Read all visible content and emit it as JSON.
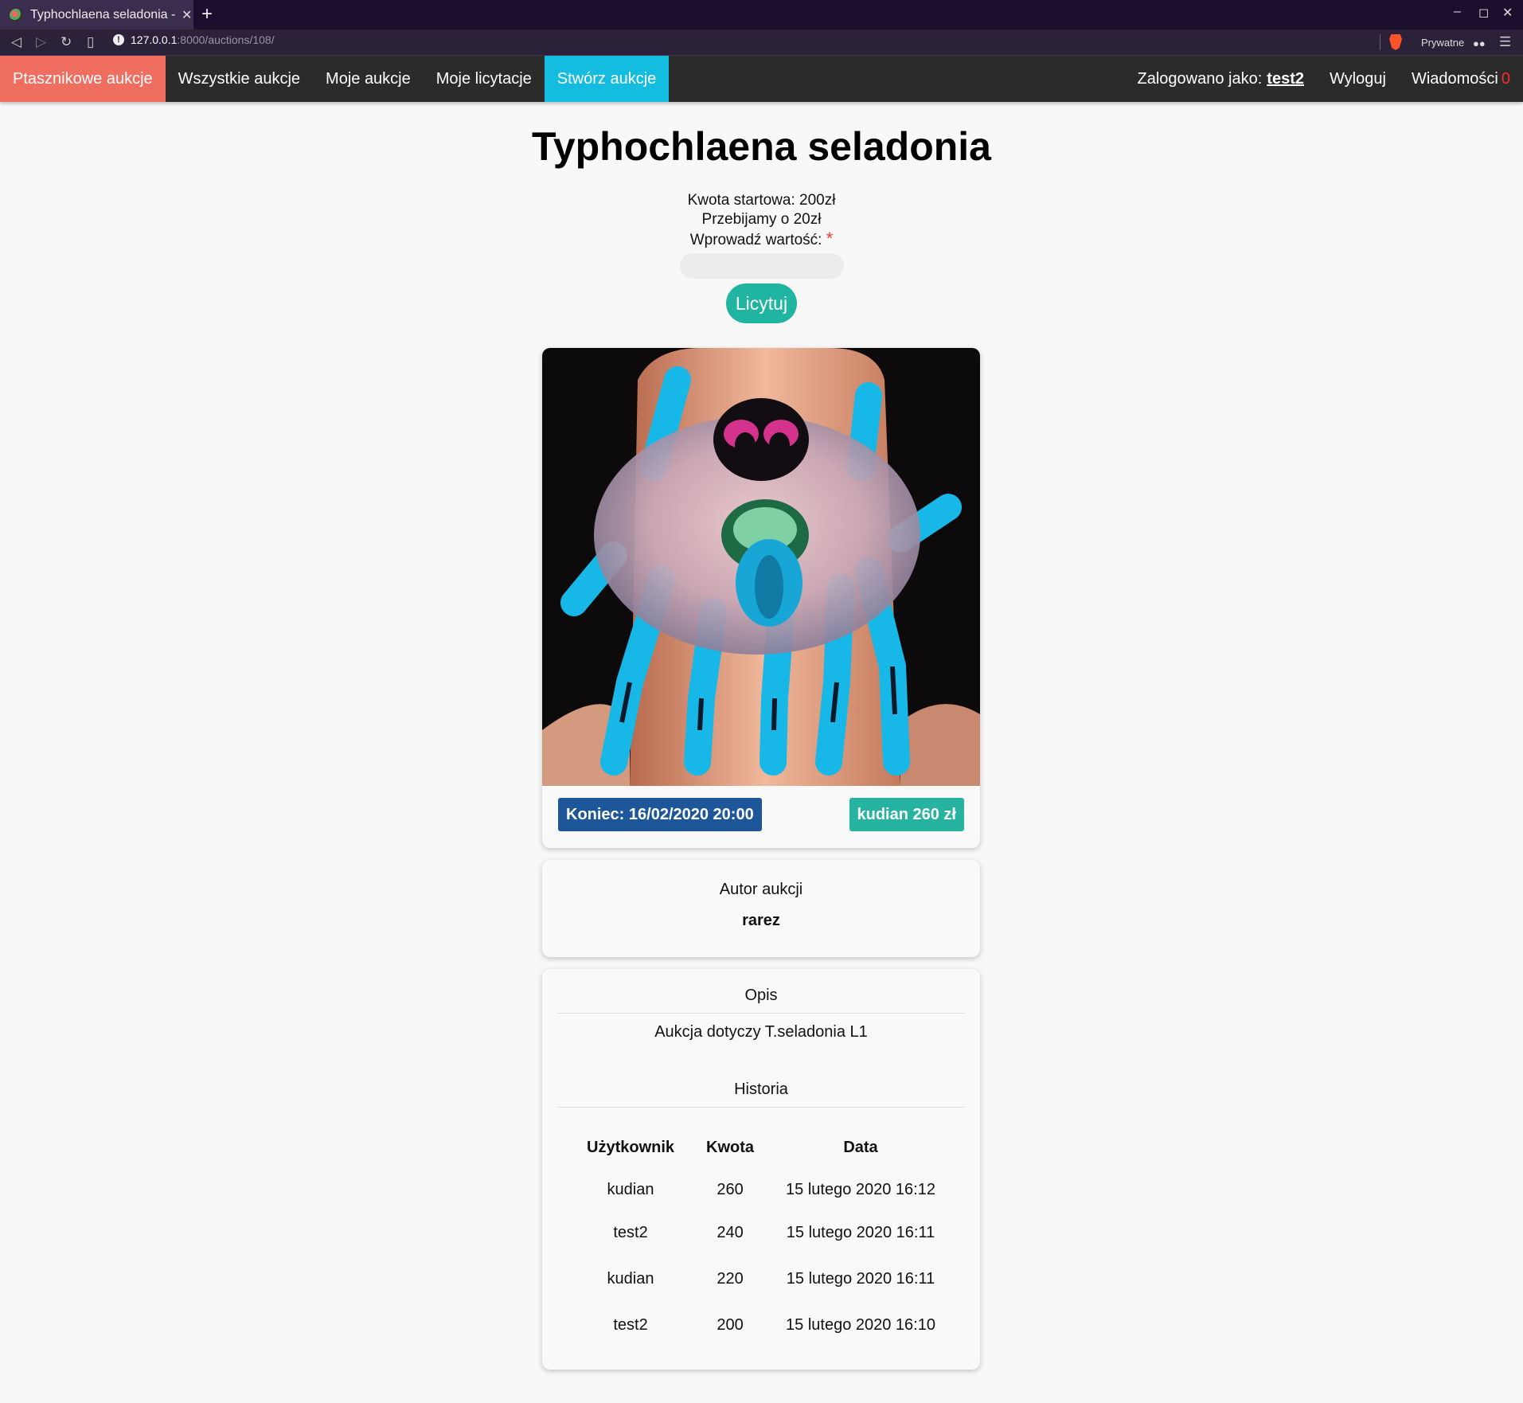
{
  "browser": {
    "tab_title": "Typhochlaena seladonia - p",
    "url_host": "127.0.0.1",
    "url_rest": ":8000/auctions/108/",
    "private_label": "Prywatne"
  },
  "navbar": {
    "brand": "Ptasznikowe aukcje",
    "all_auctions": "Wszystkie aukcje",
    "my_auctions": "Moje aukcje",
    "my_bids": "Moje licytacje",
    "create_auction": "Stwórz aukcje",
    "logged_in_as": "Zalogowano jako:",
    "username": "test2",
    "logout": "Wyloguj",
    "messages": "Wiadomości",
    "message_count": "0"
  },
  "auction": {
    "title": "Typhochlaena seladonia",
    "starting_amount": "Kwota startowa: 200zł",
    "increment": "Przebijamy o 20zł",
    "enter_value_label": "Wprowadź wartość:",
    "required_mark": "*",
    "bid_input_value": "",
    "bid_button": "Licytuj",
    "end_badge": "Koniec: 16/02/2020 20:00",
    "leader_badge": "kudian 260 zł",
    "author_label": "Autor aukcji",
    "author_name": "rarez",
    "description_label": "Opis",
    "description": "Aukcja dotyczy T.seladonia L1",
    "history_label": "Historia"
  },
  "history": {
    "columns": [
      "Użytkownik",
      "Kwota",
      "Data"
    ],
    "rows": [
      [
        "kudian",
        "260",
        "15 lutego 2020 16:12"
      ],
      [
        "test2",
        "240",
        "15 lutego 2020 16:11"
      ],
      [
        "kudian",
        "220",
        "15 lutego 2020 16:11"
      ],
      [
        "test2",
        "200",
        "15 lutego 2020 16:10"
      ]
    ]
  },
  "colors": {
    "brand": "#f06e60",
    "create": "#14bde0",
    "bid_button": "#1fb5a1",
    "end_badge": "#1e5799",
    "leader_badge": "#26b3a0"
  }
}
